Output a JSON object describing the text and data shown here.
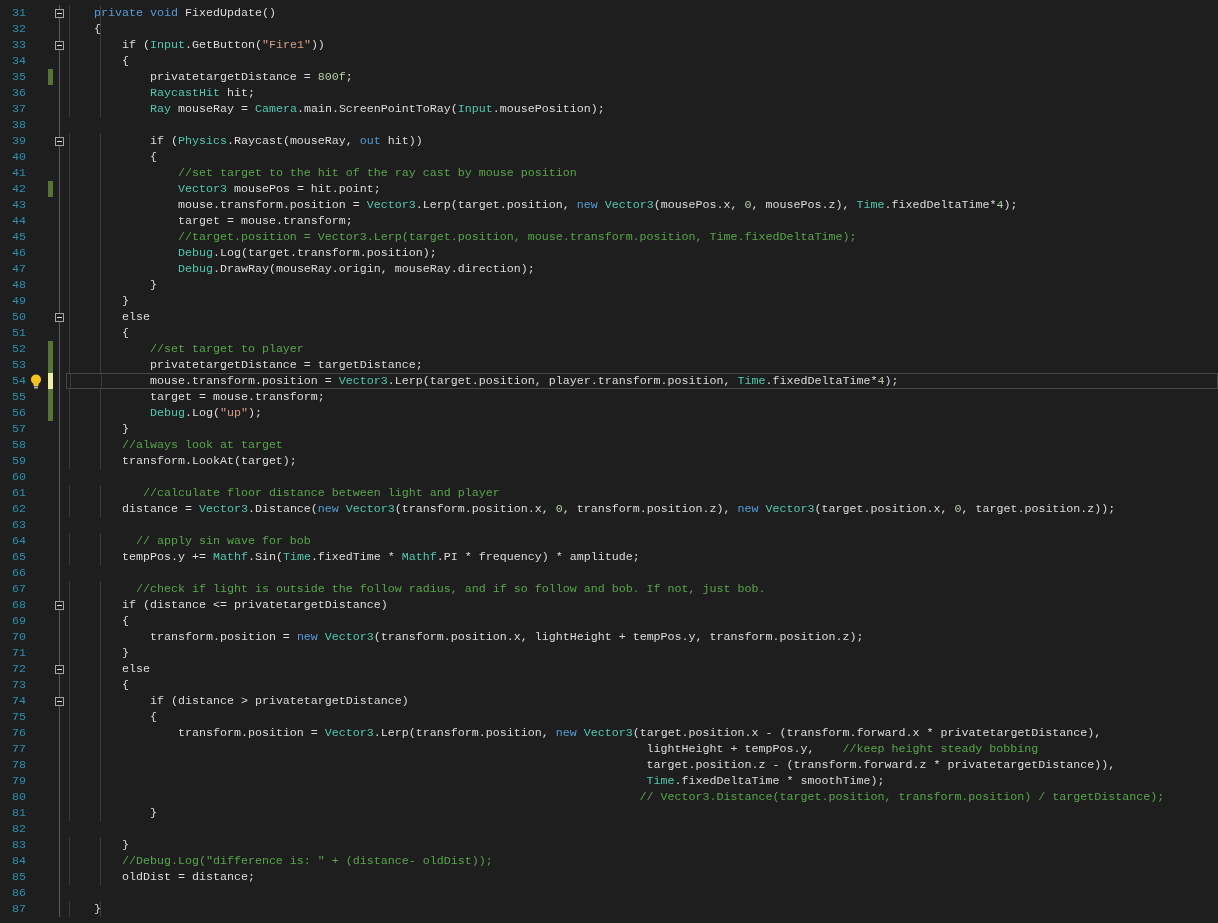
{
  "editor": {
    "lines": [
      {
        "number": "31",
        "fold": {
          "expanded": true
        },
        "current": false,
        "tokens": [
          {
            "text": "private void",
            "kind": "keyword"
          },
          {
            "text": " FixedUpdate()",
            "kind": "plain"
          }
        ]
      },
      {
        "number": "32",
        "current": false,
        "tokens": [
          {
            "text": "{",
            "kind": "plain"
          }
        ]
      },
      {
        "number": "33",
        "fold": {
          "expanded": true
        },
        "current": false,
        "tokens": [
          {
            "text": "    if (",
            "kind": "plain"
          },
          {
            "text": "Input",
            "kind": "type"
          },
          {
            "text": ".GetButton(",
            "kind": "plain"
          },
          {
            "text": "\"Fire1\"",
            "kind": "string"
          },
          {
            "text": "))",
            "kind": "plain"
          }
        ]
      },
      {
        "number": "34",
        "current": false,
        "tokens": [
          {
            "text": "    {",
            "kind": "plain"
          }
        ]
      },
      {
        "number": "35",
        "change_marker": {
          "color": "#577430"
        },
        "current": false,
        "tokens": [
          {
            "text": "        privatetargetDistance = ",
            "kind": "plain"
          },
          {
            "text": "800f",
            "kind": "number"
          },
          {
            "text": ";",
            "kind": "plain"
          }
        ]
      },
      {
        "number": "36",
        "current": false,
        "tokens": [
          {
            "text": "        RaycastHit",
            "kind": "type"
          },
          {
            "text": " hit;",
            "kind": "plain"
          }
        ]
      },
      {
        "number": "37",
        "current": false,
        "tokens": [
          {
            "text": "        Ray",
            "kind": "type"
          },
          {
            "text": " mouseRay = ",
            "kind": "plain"
          },
          {
            "text": "Camera",
            "kind": "type"
          },
          {
            "text": ".main.ScreenPointToRay(",
            "kind": "plain"
          },
          {
            "text": "Input",
            "kind": "type"
          },
          {
            "text": ".mousePosition);",
            "kind": "plain"
          }
        ]
      },
      {
        "number": "38",
        "current": false
      },
      {
        "number": "39",
        "fold": {
          "expanded": true
        },
        "current": false,
        "tokens": [
          {
            "text": "        if (",
            "kind": "plain"
          },
          {
            "text": "Physics",
            "kind": "type"
          },
          {
            "text": ".Raycast(mouseRay, ",
            "kind": "plain"
          },
          {
            "text": "out",
            "kind": "keyword"
          },
          {
            "text": " hit))",
            "kind": "plain"
          }
        ]
      },
      {
        "number": "40",
        "current": false,
        "tokens": [
          {
            "text": "        {",
            "kind": "plain"
          }
        ]
      },
      {
        "number": "41",
        "current": false,
        "tokens": [
          {
            "text": "            //set target to the hit of the ray cast by mouse position",
            "kind": "comment"
          }
        ]
      },
      {
        "number": "42",
        "change_marker": {
          "color": "#577430"
        },
        "current": false,
        "tokens": [
          {
            "text": "            Vector3",
            "kind": "type"
          },
          {
            "text": " mousePos = hit.point;",
            "kind": "plain"
          }
        ]
      },
      {
        "number": "43",
        "current": false,
        "tokens": [
          {
            "text": "            mouse.transform.position = ",
            "kind": "plain"
          },
          {
            "text": "Vector3",
            "kind": "type"
          },
          {
            "text": ".Lerp(target.position, ",
            "kind": "plain"
          },
          {
            "text": "new ",
            "kind": "keyword"
          },
          {
            "text": "Vector3",
            "kind": "type"
          },
          {
            "text": "(mousePos.x, ",
            "kind": "plain"
          },
          {
            "text": "0",
            "kind": "number"
          },
          {
            "text": ", mousePos.z), ",
            "kind": "plain"
          },
          {
            "text": "Time",
            "kind": "type"
          },
          {
            "text": ".fixedDeltaTime*",
            "kind": "plain"
          },
          {
            "text": "4",
            "kind": "number"
          },
          {
            "text": ");",
            "kind": "plain"
          }
        ]
      },
      {
        "number": "44",
        "current": false,
        "tokens": [
          {
            "text": "            target = mouse.transform;",
            "kind": "plain"
          }
        ]
      },
      {
        "number": "45",
        "current": false,
        "tokens": [
          {
            "text": "            //target.position = Vector3.Lerp(target.position, mouse.transform.position, Time.fixedDeltaTime);",
            "kind": "comment"
          }
        ]
      },
      {
        "number": "46",
        "current": false,
        "tokens": [
          {
            "text": "            Debug",
            "kind": "type"
          },
          {
            "text": ".Log(target.transform.position);",
            "kind": "plain"
          }
        ]
      },
      {
        "number": "47",
        "current": false,
        "tokens": [
          {
            "text": "            Debug",
            "kind": "type"
          },
          {
            "text": ".DrawRay(mouseRay.origin, mouseRay.direction);",
            "kind": "plain"
          }
        ]
      },
      {
        "number": "48",
        "current": false,
        "tokens": [
          {
            "text": "        }",
            "kind": "plain"
          }
        ]
      },
      {
        "number": "49",
        "current": false,
        "tokens": [
          {
            "text": "    }",
            "kind": "plain"
          }
        ]
      },
      {
        "number": "50",
        "fold": {
          "expanded": true
        },
        "current": false,
        "tokens": [
          {
            "text": "    else",
            "kind": "plain"
          }
        ]
      },
      {
        "number": "51",
        "current": false,
        "tokens": [
          {
            "text": "    {",
            "kind": "plain"
          }
        ]
      },
      {
        "number": "52",
        "change_marker": {
          "color": "#577430"
        },
        "current": false,
        "tokens": [
          {
            "text": "        //set target to player",
            "kind": "comment"
          }
        ]
      },
      {
        "number": "53",
        "change_marker": {
          "color": "#577430"
        },
        "current": false,
        "tokens": [
          {
            "text": "        privatetargetDistance = targetDistance;",
            "kind": "plain"
          }
        ]
      },
      {
        "number": "54",
        "change_marker": {
          "color": "#efefa0"
        },
        "current": true,
        "tokens": [
          {
            "text": "        mouse.transform.position = ",
            "kind": "plain"
          },
          {
            "text": "Vector3",
            "kind": "type"
          },
          {
            "text": ".Lerp(target.position, player.transform.position, ",
            "kind": "plain"
          },
          {
            "text": "Time",
            "kind": "type"
          },
          {
            "text": ".fixedDeltaTime*",
            "kind": "plain"
          },
          {
            "text": "4",
            "kind": "number"
          },
          {
            "text": ");",
            "kind": "plain"
          }
        ]
      },
      {
        "number": "55",
        "change_marker": {
          "color": "#577430"
        },
        "current": false,
        "tokens": [
          {
            "text": "        target = mouse.transform;",
            "kind": "plain"
          }
        ]
      },
      {
        "number": "56",
        "change_marker": {
          "color": "#577430"
        },
        "current": false,
        "tokens": [
          {
            "text": "        Debug",
            "kind": "type"
          },
          {
            "text": ".Log(",
            "kind": "plain"
          },
          {
            "text": "\"up\"",
            "kind": "string"
          },
          {
            "text": ");",
            "kind": "plain"
          }
        ]
      },
      {
        "number": "57",
        "current": false,
        "tokens": [
          {
            "text": "    }",
            "kind": "plain"
          }
        ]
      },
      {
        "number": "58",
        "current": false,
        "tokens": [
          {
            "text": "    //always look at target",
            "kind": "comment"
          }
        ]
      },
      {
        "number": "59",
        "current": false,
        "tokens": [
          {
            "text": "    transform.LookAt(target);",
            "kind": "plain"
          }
        ]
      },
      {
        "number": "60",
        "current": false
      },
      {
        "number": "61",
        "current": false,
        "tokens": [
          {
            "text": "       //calculate floor distance between light and player",
            "kind": "comment"
          }
        ]
      },
      {
        "number": "62",
        "current": false,
        "tokens": [
          {
            "text": "    distance = ",
            "kind": "plain"
          },
          {
            "text": "Vector3",
            "kind": "type"
          },
          {
            "text": ".Distance(",
            "kind": "plain"
          },
          {
            "text": "new ",
            "kind": "keyword"
          },
          {
            "text": "Vector3",
            "kind": "type"
          },
          {
            "text": "(transform.position.x, ",
            "kind": "plain"
          },
          {
            "text": "0",
            "kind": "number"
          },
          {
            "text": ", transform.position.z), ",
            "kind": "plain"
          },
          {
            "text": "new ",
            "kind": "keyword"
          },
          {
            "text": "Vector3",
            "kind": "type"
          },
          {
            "text": "(target.position.x, ",
            "kind": "plain"
          },
          {
            "text": "0",
            "kind": "number"
          },
          {
            "text": ", target.position.z));",
            "kind": "plain"
          }
        ]
      },
      {
        "number": "63",
        "current": false
      },
      {
        "number": "64",
        "current": false,
        "tokens": [
          {
            "text": "      // apply sin wave for bob",
            "kind": "comment"
          }
        ]
      },
      {
        "number": "65",
        "current": false,
        "tokens": [
          {
            "text": "    tempPos.y += ",
            "kind": "plain"
          },
          {
            "text": "Mathf",
            "kind": "type"
          },
          {
            "text": ".Sin(",
            "kind": "plain"
          },
          {
            "text": "Time",
            "kind": "type"
          },
          {
            "text": ".fixedTime * ",
            "kind": "plain"
          },
          {
            "text": "Mathf",
            "kind": "type"
          },
          {
            "text": ".PI * frequency) * amplitude;",
            "kind": "plain"
          }
        ]
      },
      {
        "number": "66",
        "current": false
      },
      {
        "number": "67",
        "current": false,
        "tokens": [
          {
            "text": "      //check if light is outside the follow radius, and if so follow and bob. If not, just bob.",
            "kind": "comment"
          }
        ]
      },
      {
        "number": "68",
        "fold": {
          "expanded": true
        },
        "current": false,
        "tokens": [
          {
            "text": "    if (distance <= privatetargetDistance)",
            "kind": "plain"
          }
        ]
      },
      {
        "number": "69",
        "current": false,
        "tokens": [
          {
            "text": "    {",
            "kind": "plain"
          }
        ]
      },
      {
        "number": "70",
        "current": false,
        "tokens": [
          {
            "text": "        transform.position = ",
            "kind": "plain"
          },
          {
            "text": "new ",
            "kind": "keyword"
          },
          {
            "text": "Vector3",
            "kind": "type"
          },
          {
            "text": "(transform.position.x, lightHeight + tempPos.y, transform.position.z);",
            "kind": "plain"
          }
        ]
      },
      {
        "number": "71",
        "current": false,
        "tokens": [
          {
            "text": "    }",
            "kind": "plain"
          }
        ]
      },
      {
        "number": "72",
        "fold": {
          "expanded": true
        },
        "current": false,
        "tokens": [
          {
            "text": "    else",
            "kind": "plain"
          }
        ]
      },
      {
        "number": "73",
        "current": false,
        "tokens": [
          {
            "text": "    {",
            "kind": "plain"
          }
        ]
      },
      {
        "number": "74",
        "fold": {
          "expanded": true
        },
        "current": false,
        "tokens": [
          {
            "text": "        if (distance > privatetargetDistance)",
            "kind": "plain"
          }
        ]
      },
      {
        "number": "75",
        "current": false,
        "tokens": [
          {
            "text": "        {",
            "kind": "plain"
          }
        ]
      },
      {
        "number": "76",
        "current": false,
        "tokens": [
          {
            "text": "            transform.position = ",
            "kind": "plain"
          },
          {
            "text": "Vector3",
            "kind": "type"
          },
          {
            "text": ".Lerp(transform.position, ",
            "kind": "plain"
          },
          {
            "text": "new ",
            "kind": "keyword"
          },
          {
            "text": "Vector3",
            "kind": "type"
          },
          {
            "text": "(target.position.x - (transform.forward.x * privatetargetDistance),",
            "kind": "plain"
          }
        ]
      },
      {
        "number": "77",
        "current": false,
        "tokens": [
          {
            "text": "                                                                               lightHeight + tempPos.y,    ",
            "kind": "plain"
          },
          {
            "text": "//keep height steady bobbing",
            "kind": "comment"
          }
        ]
      },
      {
        "number": "78",
        "current": false,
        "tokens": [
          {
            "text": "                                                                               target.position.z - (transform.forward.z * privatetargetDistance)),",
            "kind": "plain"
          }
        ]
      },
      {
        "number": "79",
        "current": false,
        "tokens": [
          {
            "text": "                                                                               Time",
            "kind": "type"
          },
          {
            "text": ".fixedDeltaTime * smoothTime);",
            "kind": "plain"
          }
        ]
      },
      {
        "number": "80",
        "current": false,
        "tokens": [
          {
            "text": "                                                                              // Vector3.Distance(target.position, transform.position) / targetDistance);",
            "kind": "comment"
          }
        ]
      },
      {
        "number": "81",
        "current": false,
        "tokens": [
          {
            "text": "        }",
            "kind": "plain"
          }
        ]
      },
      {
        "number": "82",
        "current": false
      },
      {
        "number": "83",
        "current": false,
        "tokens": [
          {
            "text": "    }",
            "kind": "plain"
          }
        ]
      },
      {
        "number": "84",
        "current": false,
        "tokens": [
          {
            "text": "    //Debug.Log(\"difference is: \" + (distance- oldDist));",
            "kind": "comment"
          }
        ]
      },
      {
        "number": "85",
        "current": false,
        "tokens": [
          {
            "text": "    oldDist = distance;",
            "kind": "plain"
          }
        ]
      },
      {
        "number": "86",
        "current": false
      },
      {
        "number": "87",
        "current": false,
        "tokens": [
          {
            "text": "}",
            "kind": "plain"
          }
        ]
      }
    ]
  }
}
